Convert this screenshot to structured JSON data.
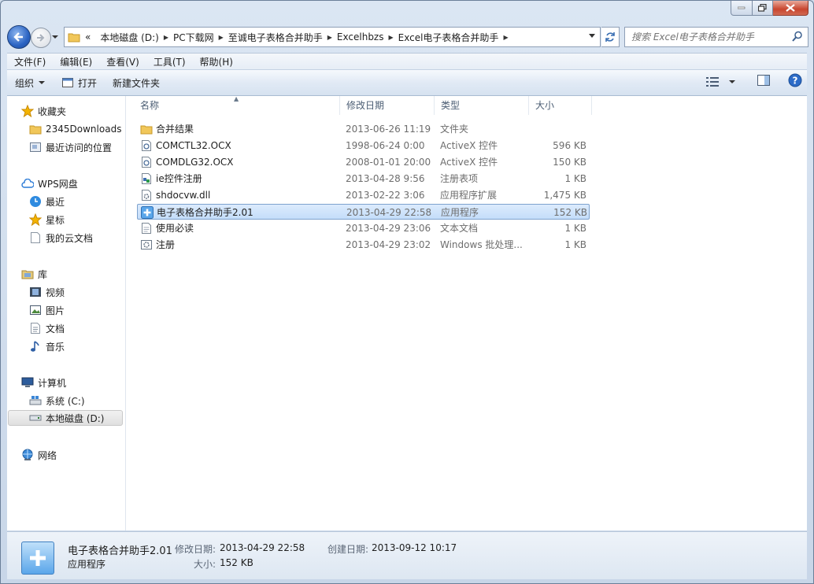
{
  "address": {
    "crumbs": [
      "«",
      "本地磁盘 (D:)",
      "PC下载网",
      "至诚电子表格合并助手",
      "Excelhbzs",
      "Excel电子表格合并助手"
    ]
  },
  "search": {
    "placeholder": "搜索 Excel电子表格合并助手"
  },
  "menu": [
    "文件(F)",
    "编辑(E)",
    "查看(V)",
    "工具(T)",
    "帮助(H)"
  ],
  "toolbar": {
    "organize": "组织",
    "open": "打开",
    "new_folder": "新建文件夹"
  },
  "nav": {
    "favorites": "收藏夹",
    "downloads": "2345Downloads",
    "recent_places": "最近访问的位置",
    "wps": "WPS网盘",
    "wps_recent": "最近",
    "wps_star": "星标",
    "wps_docs": "我的云文档",
    "library": "库",
    "videos": "视频",
    "pictures": "图片",
    "documents": "文档",
    "music": "音乐",
    "computer": "计算机",
    "drive_c": "系统 (C:)",
    "drive_d": "本地磁盘 (D:)",
    "network": "网络"
  },
  "columns": {
    "name": "名称",
    "date": "修改日期",
    "type": "类型",
    "size": "大小"
  },
  "files": [
    {
      "name": "合并结果",
      "date": "2013-06-26 11:19",
      "type": "文件夹",
      "size": "",
      "icon": "folder-icon"
    },
    {
      "name": "COMCTL32.OCX",
      "date": "1998-06-24 0:00",
      "type": "ActiveX 控件",
      "size": "596 KB",
      "icon": "activex-icon"
    },
    {
      "name": "COMDLG32.OCX",
      "date": "2008-01-01 20:00",
      "type": "ActiveX 控件",
      "size": "150 KB",
      "icon": "activex-icon"
    },
    {
      "name": "ie控件注册",
      "date": "2013-04-28 9:56",
      "type": "注册表项",
      "size": "1 KB",
      "icon": "registry-icon"
    },
    {
      "name": "shdocvw.dll",
      "date": "2013-02-22 3:06",
      "type": "应用程序扩展",
      "size": "1,475 KB",
      "icon": "dll-icon"
    },
    {
      "name": "电子表格合并助手2.01",
      "date": "2013-04-29 22:58",
      "type": "应用程序",
      "size": "152 KB",
      "icon": "app-icon"
    },
    {
      "name": "使用必读",
      "date": "2013-04-29 23:06",
      "type": "文本文档",
      "size": "1 KB",
      "icon": "text-file-icon"
    },
    {
      "name": "注册",
      "date": "2013-04-29 23:02",
      "type": "Windows 批处理...",
      "size": "1 KB",
      "icon": "batch-file-icon"
    }
  ],
  "details": {
    "name": "电子表格合并助手2.01",
    "type": "应用程序",
    "modified_label": "修改日期:",
    "modified": "2013-04-29 22:58",
    "created_label": "创建日期:",
    "created": "2013-09-12 10:17",
    "size_label": "大小:",
    "size": "152 KB"
  }
}
